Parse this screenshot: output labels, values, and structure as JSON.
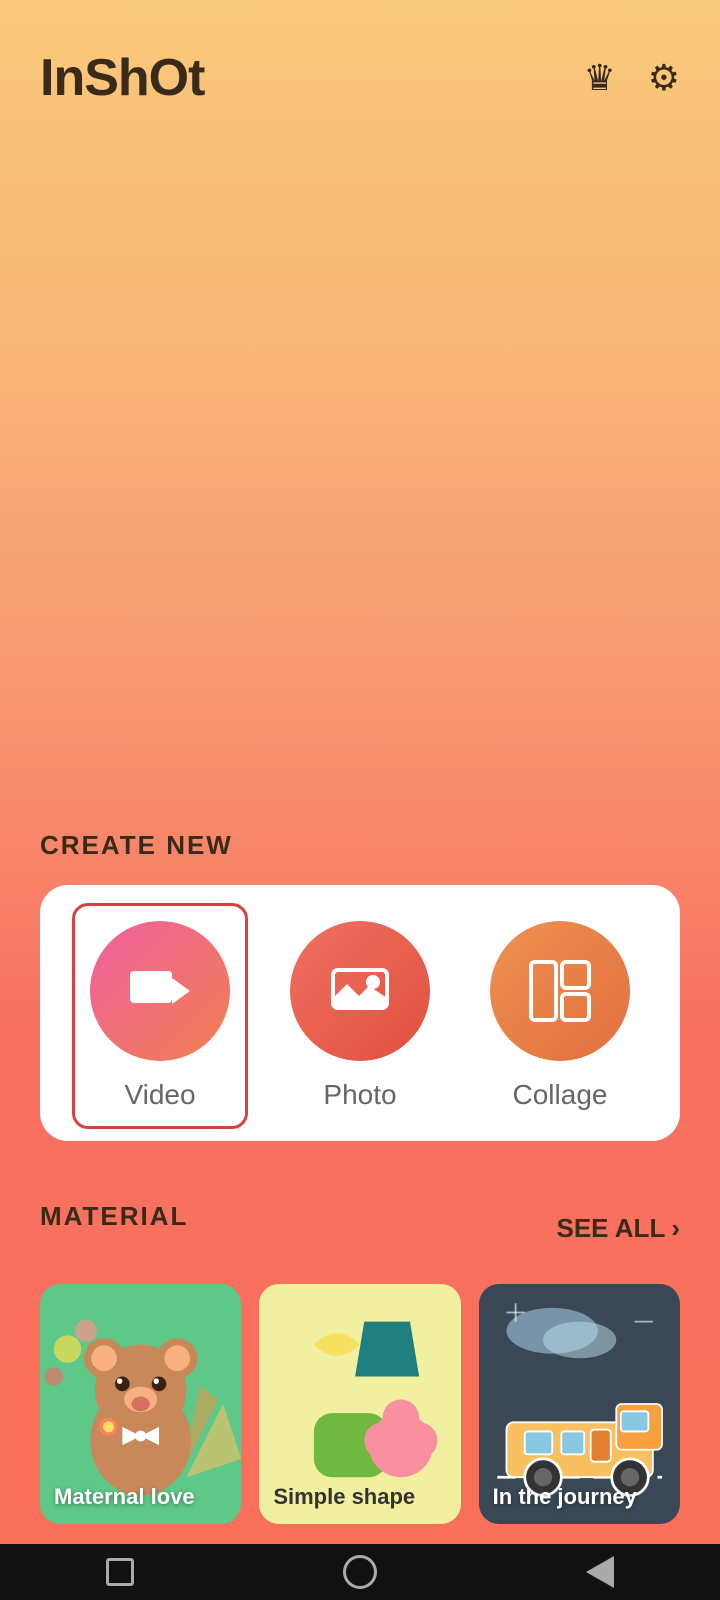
{
  "app": {
    "logo": "InShOt"
  },
  "header": {
    "crown_icon": "♛",
    "settings_icon": "⚙"
  },
  "create_new": {
    "section_title": "CREATE NEW",
    "items": [
      {
        "id": "video",
        "label": "Video",
        "selected": true
      },
      {
        "id": "photo",
        "label": "Photo",
        "selected": false
      },
      {
        "id": "collage",
        "label": "Collage",
        "selected": false
      }
    ]
  },
  "material": {
    "section_title": "MATERIAL",
    "see_all_label": "SEE ALL",
    "cards": [
      {
        "id": "maternal",
        "label": "Maternal love"
      },
      {
        "id": "simple",
        "label": "Simple shape"
      },
      {
        "id": "journey",
        "label": "In the journey"
      }
    ]
  },
  "bottom_nav": {
    "square_label": "recent-apps",
    "circle_label": "home",
    "triangle_label": "back"
  }
}
